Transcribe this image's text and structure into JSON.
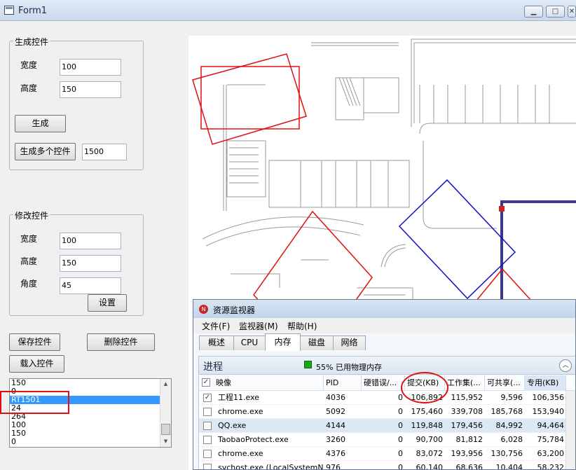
{
  "window": {
    "title": "Form1",
    "minimize": "▁",
    "maximize": "□",
    "close": "✕"
  },
  "generate_group": {
    "title": "生成控件",
    "width_label": "宽度",
    "width_value": "100",
    "height_label": "高度",
    "height_value": "150",
    "generate_button": "生成",
    "generate_many_button": "生成多个控件",
    "count_value": "1500"
  },
  "modify_group": {
    "title": "修改控件",
    "width_label": "宽度",
    "width_value": "100",
    "height_label": "高度",
    "height_value": "150",
    "angle_label": "角度",
    "angle_value": "45",
    "set_button": "设置"
  },
  "buttons": {
    "save": "保存控件",
    "delete": "删除控件",
    "load": "载入控件"
  },
  "listbox": {
    "items": [
      "150",
      "0",
      "RT1501",
      "24",
      "264",
      "100",
      "150",
      "0"
    ],
    "selected_index": 2
  },
  "resource_monitor": {
    "title": "资源监视器",
    "menu": [
      "文件(F)",
      "监视器(M)",
      "帮助(H)"
    ],
    "tabs": [
      "概述",
      "CPU",
      "内存",
      "磁盘",
      "网络"
    ],
    "active_tab": "内存",
    "section_title": "进程",
    "status": "55% 已用物理内存",
    "columns": [
      "映像",
      "PID",
      "硬错误/...",
      "提交(KB)",
      "工作集(...",
      "可共享(...",
      "专用(KB)"
    ],
    "rows": [
      {
        "checked": true,
        "image": "工程11.exe",
        "pid": "4036",
        "hard": "0",
        "commit": "106,892",
        "working": "115,952",
        "shareable": "9,596",
        "private": "106,356"
      },
      {
        "checked": false,
        "image": "chrome.exe",
        "pid": "5092",
        "hard": "0",
        "commit": "175,460",
        "working": "339,708",
        "shareable": "185,768",
        "private": "153,940"
      },
      {
        "checked": false,
        "image": "QQ.exe",
        "pid": "4144",
        "hard": "0",
        "commit": "119,848",
        "working": "179,456",
        "shareable": "84,992",
        "private": "94,464",
        "highlight": true
      },
      {
        "checked": false,
        "image": "TaobaoProtect.exe",
        "pid": "3260",
        "hard": "0",
        "commit": "90,700",
        "working": "81,812",
        "shareable": "6,028",
        "private": "75,784"
      },
      {
        "checked": false,
        "image": "chrome.exe",
        "pid": "4376",
        "hard": "0",
        "commit": "83,072",
        "working": "193,956",
        "shareable": "130,756",
        "private": "63,200"
      },
      {
        "checked": false,
        "image": "svchost.exe (LocalSystemN...",
        "pid": "976",
        "hard": "0",
        "commit": "60,140",
        "working": "68,636",
        "shareable": "10,404",
        "private": "58,232"
      }
    ]
  },
  "colors": {
    "annotation_red": "#e01010",
    "shape_blue": "#1010c8",
    "selection": "#3399ff"
  }
}
